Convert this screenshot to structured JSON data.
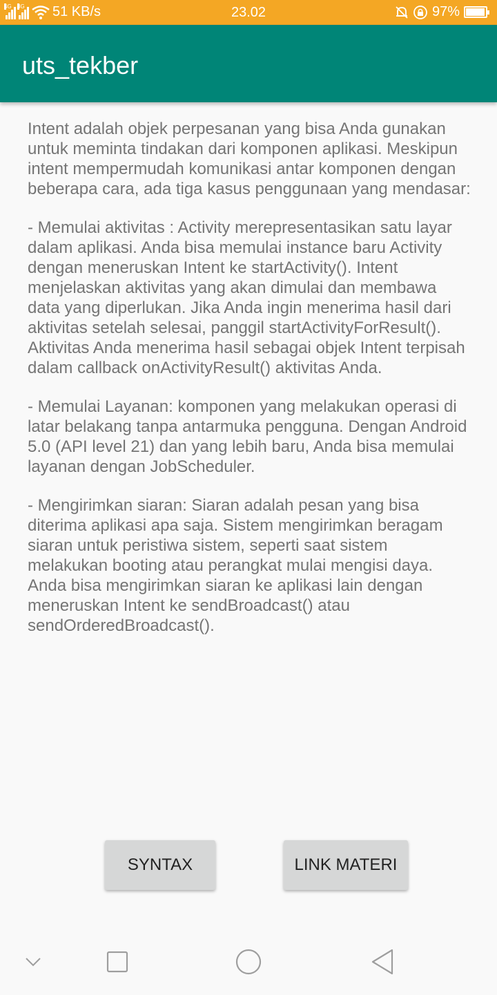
{
  "status_bar": {
    "network_speed": "51 KB/s",
    "time": "23.02",
    "battery_percent": "97%",
    "battery_level": 0.97,
    "signal_labels": [
      "4G",
      "3G"
    ],
    "icons": [
      "signal-icon",
      "wifi-icon",
      "alarm-icon",
      "rotation-lock-icon",
      "battery-charging-icon"
    ]
  },
  "app_bar": {
    "title": "uts_tekber",
    "color": "#008577"
  },
  "content": {
    "paragraphs": [
      "Intent adalah objek perpesanan yang bisa Anda gunakan untuk meminta tindakan dari komponen aplikasi. Meskipun intent mempermudah komunikasi antar komponen dengan beberapa cara, ada tiga kasus penggunaan yang mendasar:",
      "- Memulai aktivitas : Activity merepresentasikan satu layar dalam aplikasi. Anda bisa memulai instance baru Activity dengan meneruskan Intent ke startActivity(). Intent menjelaskan aktivitas yang akan dimulai dan membawa data yang diperlukan. Jika Anda ingin menerima hasil dari aktivitas setelah selesai, panggil startActivityForResult(). Aktivitas Anda menerima hasil sebagai objek Intent terpisah dalam callback onActivityResult() aktivitas Anda.",
      "- Memulai Layanan: komponen yang melakukan operasi di latar belakang tanpa antarmuka pengguna. Dengan Android 5.0 (API level 21) dan yang lebih baru, Anda bisa memulai layanan dengan JobScheduler.",
      "- Mengirimkan siaran: Siaran adalah pesan yang bisa diterima aplikasi apa saja. Sistem mengirimkan beragam siaran untuk peristiwa sistem, seperti saat sistem melakukan booting atau perangkat mulai mengisi daya. Anda bisa mengirimkan siaran ke aplikasi lain dengan meneruskan Intent ke sendBroadcast() atau sendOrderedBroadcast()."
    ]
  },
  "buttons": {
    "syntax_label": "SYNTAX",
    "link_label": "LINK MATERI"
  },
  "nav_bar": {
    "icons": [
      "chevron-down-icon",
      "recents-icon",
      "home-icon",
      "back-icon"
    ]
  },
  "colors": {
    "status_bar": "#f4a724",
    "accent": "#008577",
    "button_bg": "#d6d7d7"
  }
}
